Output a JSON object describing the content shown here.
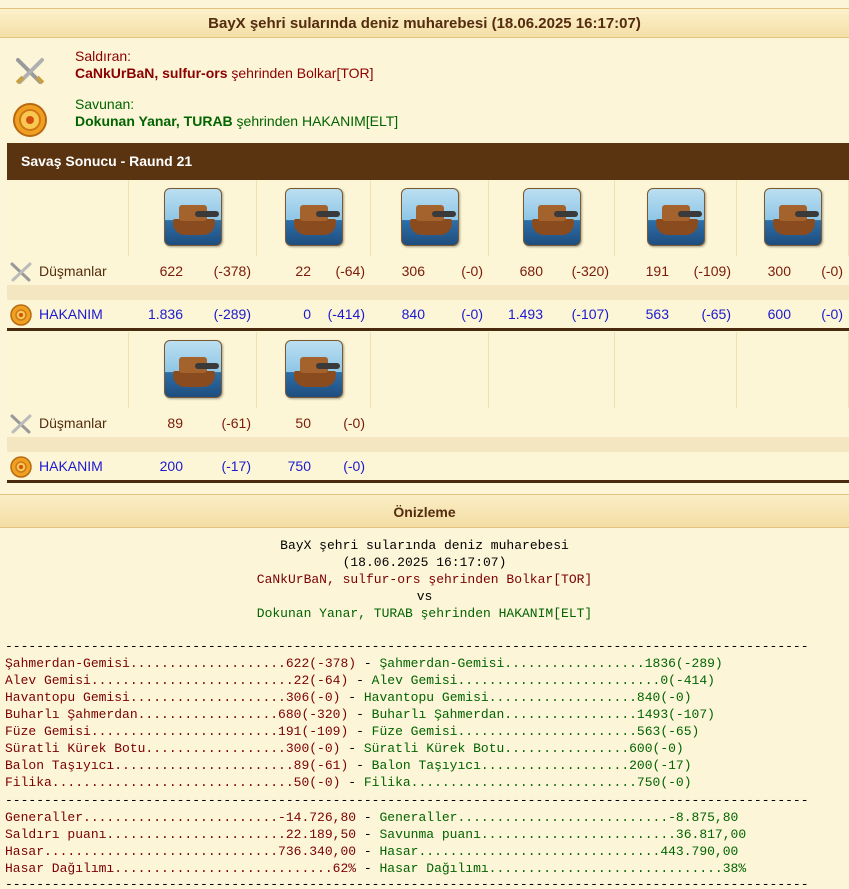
{
  "battle_title": "BayX şehri sularında deniz muharebesi (18.06.2025 16:17:07)",
  "attacker": {
    "role_label": "Saldıran:",
    "players": "CaNkUrBaN, sulfur-ors",
    "from_text": " şehrinden ",
    "city": "Bolkar[TOR]"
  },
  "defender": {
    "role_label": "Savunan:",
    "players": "Dokunan Yanar, TURAB",
    "from_text": " şehrinden ",
    "city": "HAKANIM[ELT]"
  },
  "round_title": "Savaş Sonucu - Raund 21",
  "row_labels": {
    "enemies": "Düşmanlar",
    "own": "HAKANIM"
  },
  "ships_row1": [
    {
      "icon": "steam-ram-ship-icon",
      "enemy": "622",
      "enemy_loss": "(-378)",
      "own": "1.836",
      "own_loss": "(-289)"
    },
    {
      "icon": "flame-ship-icon",
      "enemy": "22",
      "enemy_loss": "(-64)",
      "own": "0",
      "own_loss": "(-414)"
    },
    {
      "icon": "mortar-ship-icon",
      "enemy": "306",
      "enemy_loss": "(-0)",
      "own": "840",
      "own_loss": "(-0)"
    },
    {
      "icon": "paddle-ram-ship-icon",
      "enemy": "680",
      "enemy_loss": "(-320)",
      "own": "1.493",
      "own_loss": "(-107)"
    },
    {
      "icon": "rocket-ship-icon",
      "enemy": "191",
      "enemy_loss": "(-109)",
      "own": "563",
      "own_loss": "(-65)"
    },
    {
      "icon": "speedboat-icon",
      "enemy": "300",
      "enemy_loss": "(-0)",
      "own": "600",
      "own_loss": "(-0)"
    }
  ],
  "ships_row2": [
    {
      "icon": "balloon-carrier-icon",
      "enemy": "89",
      "enemy_loss": "(-61)",
      "own": "200",
      "own_loss": "(-17)"
    },
    {
      "icon": "tender-icon",
      "enemy": "50",
      "enemy_loss": "(-0)",
      "own": "750",
      "own_loss": "(-0)"
    }
  ],
  "preview": {
    "heading": "Önizleme",
    "title": "BayX şehri sularında deniz muharebesi",
    "date": "(18.06.2025 16:17:07)",
    "attacker_line": "CaNkUrBaN, sulfur-ors şehrinden Bolkar[TOR]",
    "vs": "vs",
    "defender_line": "Dokunan Yanar, TURAB şehrinden HAKANIM[ELT]",
    "separator": "-------------------------------------------------------------------------------------------------------",
    "unit_lines": [
      {
        "left": "Şahmerdan-Gemisi....................622(-378)",
        "mid": " - ",
        "right": "Şahmerdan-Gemisi..................1836(-289)"
      },
      {
        "left": "Alev Gemisi..........................22(-64)",
        "mid": " - ",
        "right": "Alev Gemisi..........................0(-414)"
      },
      {
        "left": "Havantopu Gemisi....................306(-0)",
        "mid": " - ",
        "right": "Havantopu Gemisi...................840(-0)"
      },
      {
        "left": "Buharlı Şahmerdan..................680(-320)",
        "mid": " - ",
        "right": "Buharlı Şahmerdan.................1493(-107)"
      },
      {
        "left": "Füze Gemisi........................191(-109)",
        "mid": " - ",
        "right": "Füze Gemisi.......................563(-65)"
      },
      {
        "left": "Süratli Kürek Botu..................300(-0)",
        "mid": " - ",
        "right": "Süratli Kürek Botu................600(-0)"
      },
      {
        "left": "Balon Taşıyıcı.......................89(-61)",
        "mid": " - ",
        "right": "Balon Taşıyıcı...................200(-17)"
      },
      {
        "left": "Filika...............................50(-0)",
        "mid": " - ",
        "right": "Filika.............................750(-0)"
      }
    ],
    "summary_lines": [
      {
        "left": "Generaller.........................-14.726,80",
        "mid": " - ",
        "right": "Generaller...........................-8.875,80"
      },
      {
        "left": "Saldırı puanı.......................22.189,50",
        "mid": " - ",
        "right": "Savunma puanı.........................36.817,00"
      },
      {
        "left": "Hasar..............................736.340,00",
        "mid": " - ",
        "right": "Hasar...............................443.790,00"
      },
      {
        "left": "Hasar Dağılımı............................62%",
        "mid": " - ",
        "right": "Hasar Dağılımı..............................38%"
      }
    ]
  }
}
